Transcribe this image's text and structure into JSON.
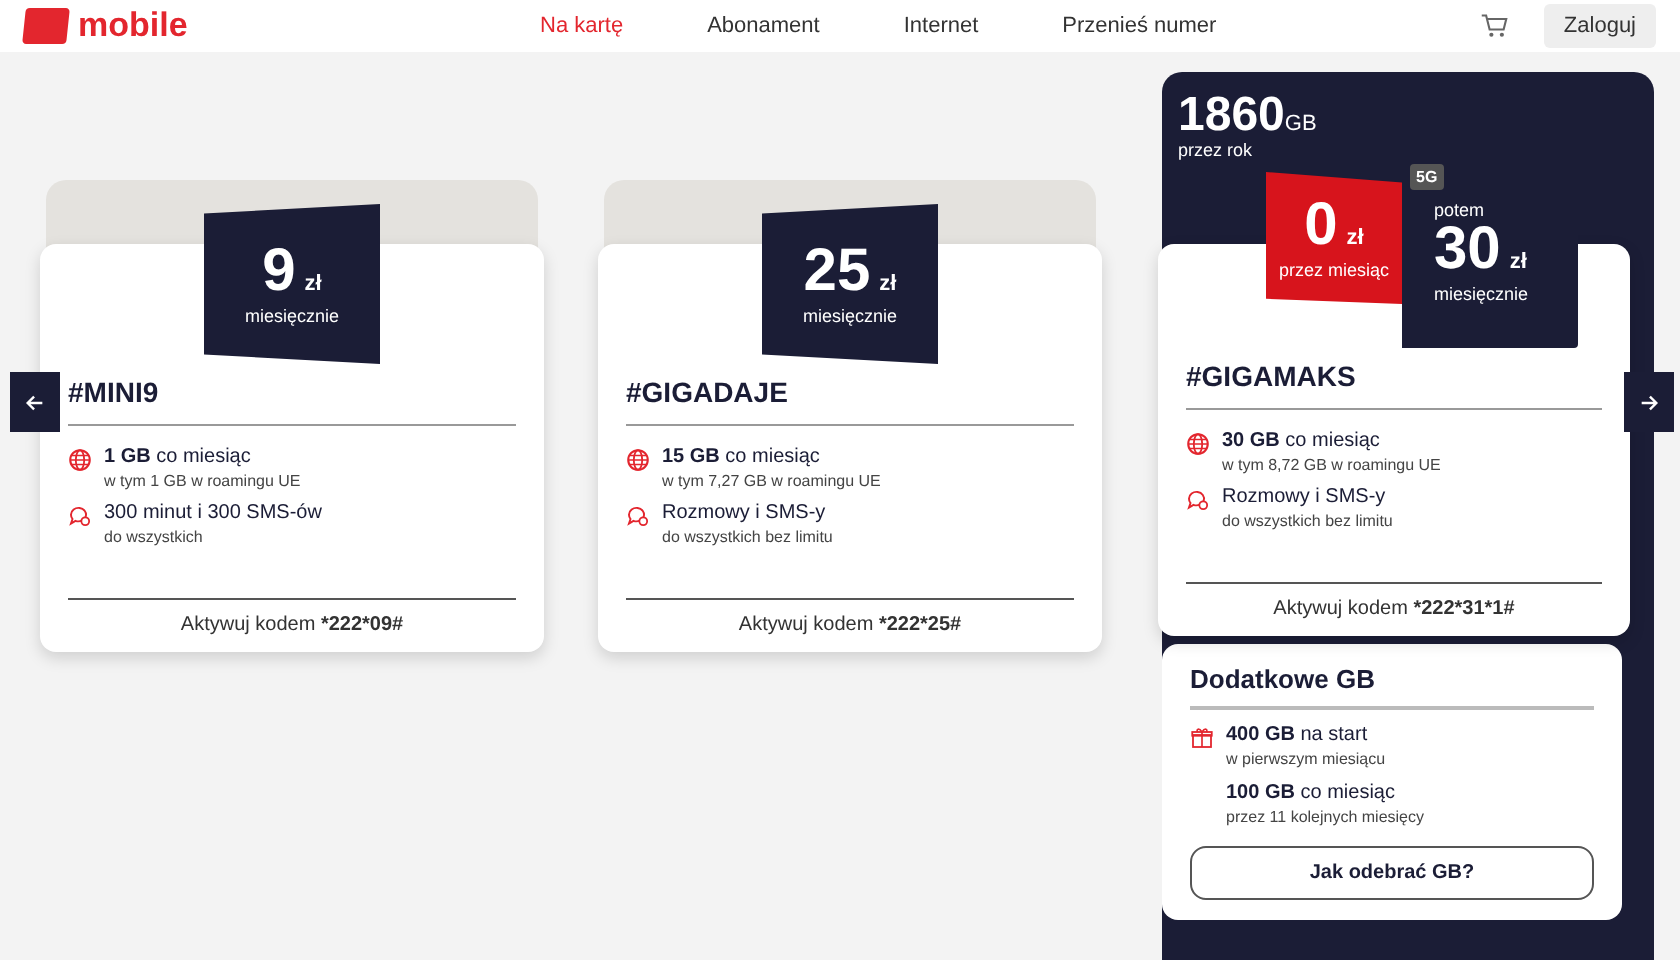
{
  "header": {
    "logo_text": "mobile",
    "nav": [
      {
        "label": "Na kartę",
        "selected": true
      },
      {
        "label": "Abonament",
        "selected": false
      },
      {
        "label": "Internet",
        "selected": false
      },
      {
        "label": "Przenieś numer",
        "selected": false
      }
    ],
    "login": "Zaloguj"
  },
  "plans": [
    {
      "kind": "standard",
      "price": "9",
      "currency": "zł",
      "period": "miesięcznie",
      "name": "#MINI9",
      "features": [
        {
          "kind": "data",
          "main": "**1 GB** co miesiąc",
          "sub": "w tym 1 GB w roamingu UE"
        },
        {
          "kind": "calls",
          "main": "300 minut i 300 SMS-ów",
          "sub": "do wszystkich"
        }
      ],
      "activation_label": "Aktywuj kodem",
      "activation_code": "*222*09#"
    },
    {
      "kind": "standard",
      "price": "25",
      "currency": "zł",
      "period": "miesięcznie",
      "name": "#GIGADAJE",
      "features": [
        {
          "kind": "data",
          "main": "**15 GB** co miesiąc",
          "sub": "w tym 7,27 GB w roamingu UE"
        },
        {
          "kind": "calls",
          "main": "Rozmowy i SMS-y",
          "sub": "do wszystkich bez limitu"
        }
      ],
      "activation_label": "Aktywuj kodem",
      "activation_code": "*222*25#"
    },
    {
      "kind": "featured",
      "bonus_amount": "1860",
      "bonus_unit": "GB",
      "bonus_period": "przez rok",
      "promo": {
        "price": "0",
        "currency": "zł",
        "period": "przez miesiąc"
      },
      "badge": "5G",
      "then_label": "potem",
      "price": "30",
      "currency": "zł",
      "period": "miesięcznie",
      "name": "#GIGAMAKS",
      "features": [
        {
          "kind": "data",
          "main": "**30 GB** co miesiąc",
          "sub": "w tym 8,72 GB w roamingu UE"
        },
        {
          "kind": "calls",
          "main": "Rozmowy i SMS-y",
          "sub": "do wszystkich bez limitu"
        }
      ],
      "activation_label": "Aktywuj kodem",
      "activation_code": "*222*31*1#",
      "extra": {
        "title": "Dodatkowe GB",
        "items": [
          {
            "main": "**400 GB** na start",
            "sub": "w pierwszym miesiącu"
          },
          {
            "main": "**100 GB** co miesiąc",
            "sub": "przez 11 kolejnych miesięcy"
          }
        ],
        "button": "Jak odebrać GB?"
      }
    }
  ]
}
